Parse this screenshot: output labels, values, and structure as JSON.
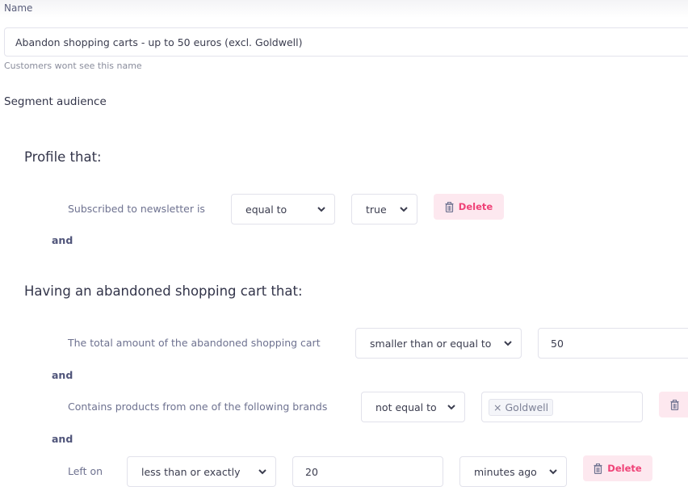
{
  "name_field": {
    "label": "Name",
    "value": "Abandon shopping carts - up to 50 euros (excl. Goldwell)",
    "help": "Customers wont see this name"
  },
  "segment": {
    "title": "Segment audience",
    "groups": [
      {
        "title": "Profile that:",
        "conditions": [
          {
            "label": "Subscribed to newsletter is",
            "operator": "equal to",
            "value": "true",
            "delete_label": "Delete"
          }
        ],
        "connector": "and"
      },
      {
        "title": "Having an abandoned shopping cart that:",
        "conditions": [
          {
            "label": "The total amount of the abandoned shopping cart",
            "operator": "smaller than or equal to",
            "value": "50"
          },
          {
            "label": "Contains products from one of the following brands",
            "operator": "not equal to",
            "tags": [
              "Goldwell"
            ]
          },
          {
            "label": "Left on",
            "operator": "less than or exactly",
            "value": "20",
            "unit": "minutes ago",
            "delete_label": "Delete"
          }
        ],
        "connectors": [
          "and",
          "and"
        ]
      }
    ]
  },
  "colors": {
    "delete_text": "#ef4277",
    "delete_bg": "#fde8ef",
    "and_text": "#50557a"
  }
}
